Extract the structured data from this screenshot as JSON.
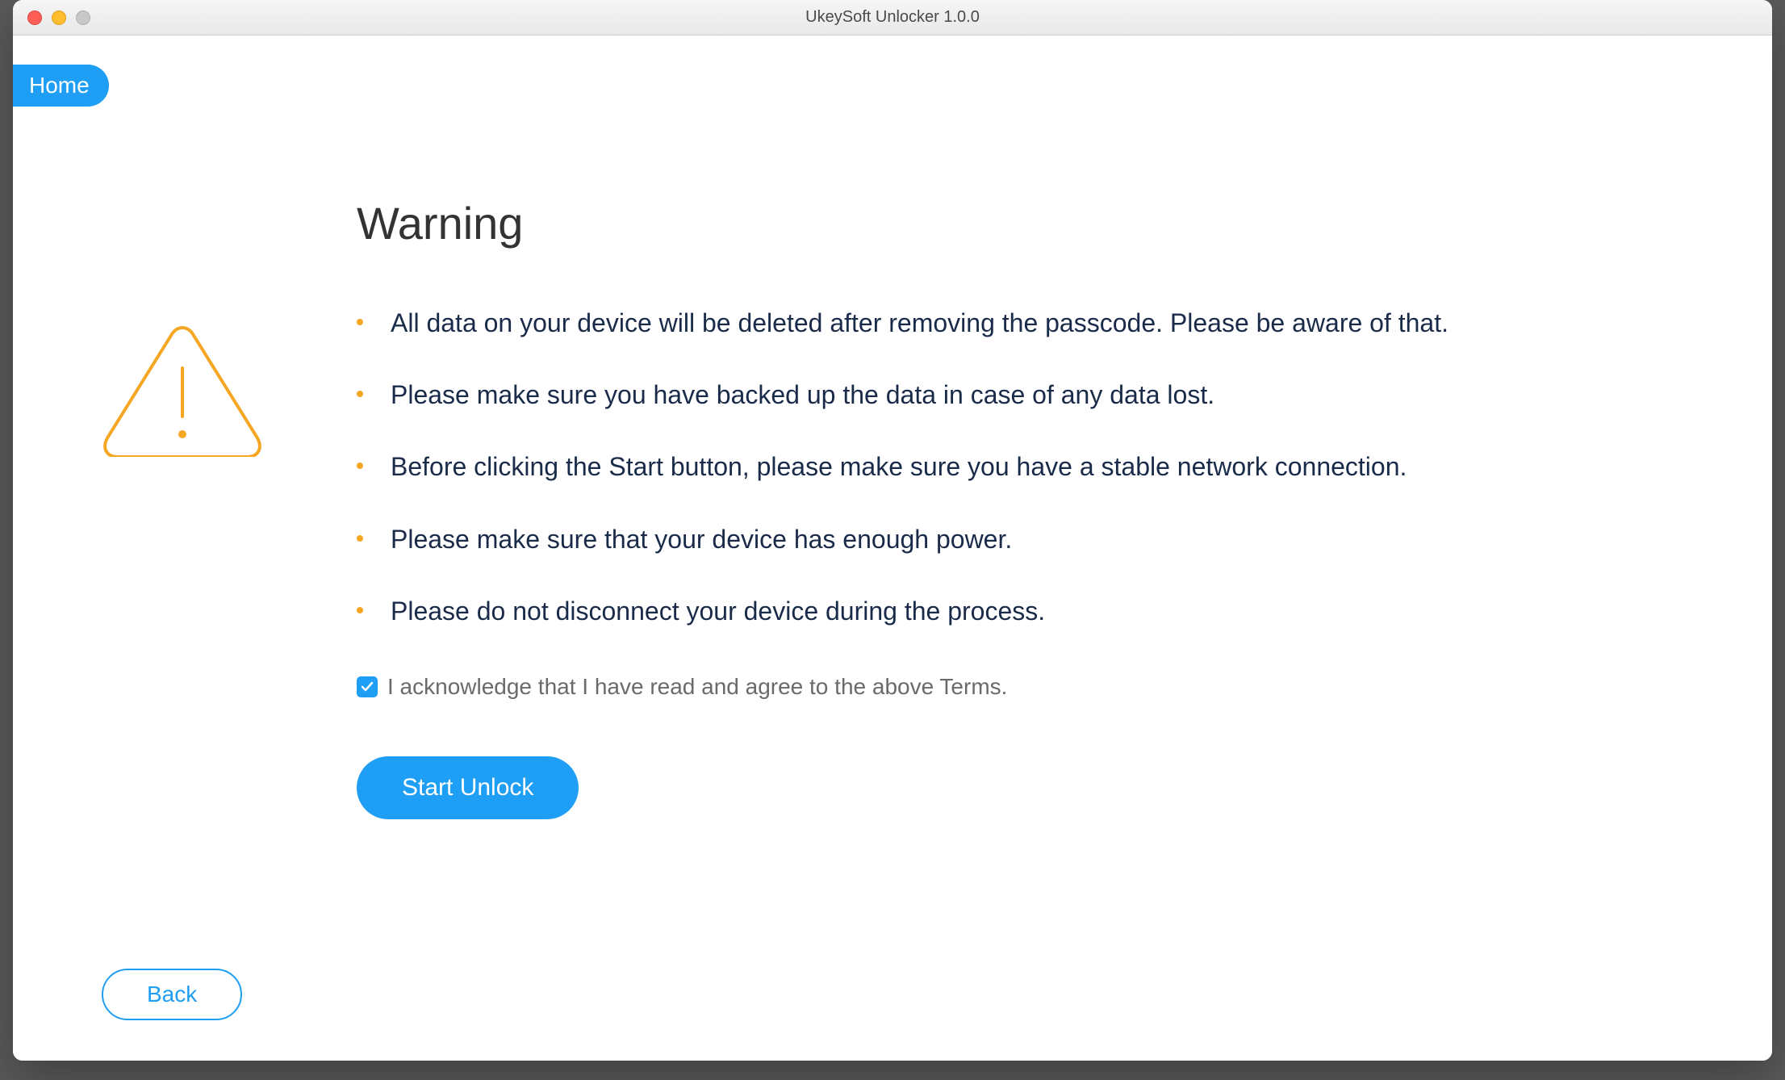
{
  "window": {
    "title": "UkeySoft Unlocker 1.0.0"
  },
  "nav": {
    "home_label": "Home"
  },
  "main": {
    "heading": "Warning",
    "bullets": [
      "All data on your device will be deleted after removing the passcode. Please be aware of that.",
      "Please make sure you have backed up the data in case of any data lost.",
      "Before clicking the Start button, please make sure you have a stable network connection.",
      "Please make sure that your device has enough power.",
      "Please do not disconnect your device during the process."
    ],
    "ack_label": "I acknowledge that I have read and agree to the above Terms.",
    "ack_checked": true,
    "start_label": "Start Unlock",
    "back_label": "Back"
  },
  "icons": {
    "warning": "warning-triangle-icon",
    "checkmark": "checkmark-icon"
  },
  "colors": {
    "accent": "#1e9ef4",
    "warning": "#f5a623",
    "text_dark": "#1a2b4a"
  }
}
